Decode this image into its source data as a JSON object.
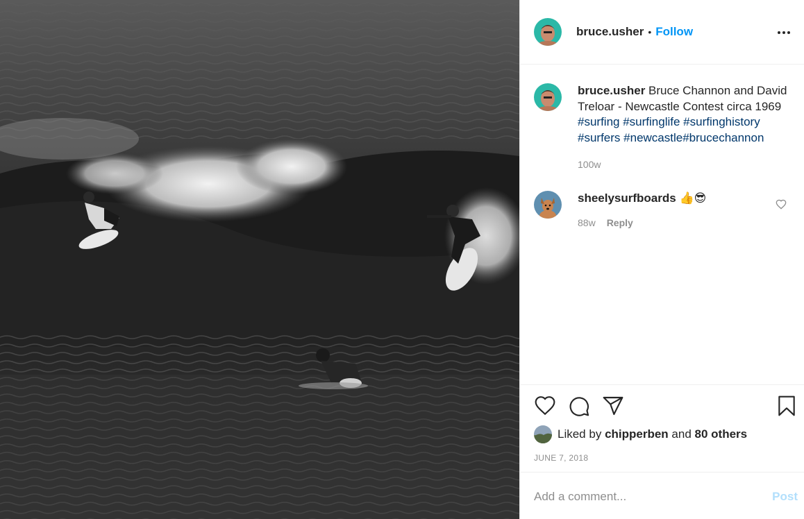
{
  "author": {
    "username": "bruce.usher",
    "separator": "•",
    "follow_label": "Follow"
  },
  "caption": {
    "username": "bruce.usher",
    "text": "Bruce Channon and David Treloar - Newcastle Contest circa 1969",
    "hashtags": [
      "#surfing",
      "#surfinglife",
      "#surfinghistory",
      "#surfers",
      "#newcastle",
      "#brucechannon"
    ],
    "age": "100w"
  },
  "comments": [
    {
      "username": "sheelysurfboards",
      "text": "👍😎",
      "age": "88w",
      "reply_label": "Reply"
    }
  ],
  "likes": {
    "prefix": "Liked by",
    "user": "chipperben",
    "joiner": "and",
    "others": "80 others"
  },
  "date": "JUNE 7, 2018",
  "add_comment": {
    "placeholder": "Add a comment...",
    "post_label": "Post"
  },
  "colors": {
    "link_blue": "#0095f6",
    "hashtag": "#00376b",
    "muted": "#8e8e8e",
    "post_disabled": "#b2dffc"
  },
  "icons": {
    "like": "heart-outline-icon",
    "comment": "speech-bubble-icon",
    "share": "paper-plane-icon",
    "save": "bookmark-icon",
    "more": "ellipsis-icon",
    "comment_like": "small-heart-icon"
  }
}
